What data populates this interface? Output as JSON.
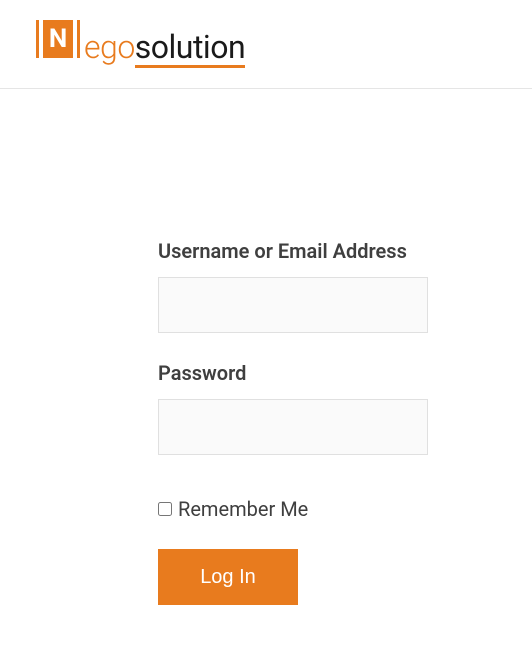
{
  "brand": {
    "logo_letter": "N",
    "logo_part1": "ego",
    "logo_part2": "solution",
    "accent_color": "#e87b1e"
  },
  "form": {
    "username_label": "Username or Email Address",
    "username_value": "",
    "password_label": "Password",
    "password_value": "",
    "remember_label": "Remember Me",
    "remember_checked": false,
    "submit_label": "Log In"
  }
}
